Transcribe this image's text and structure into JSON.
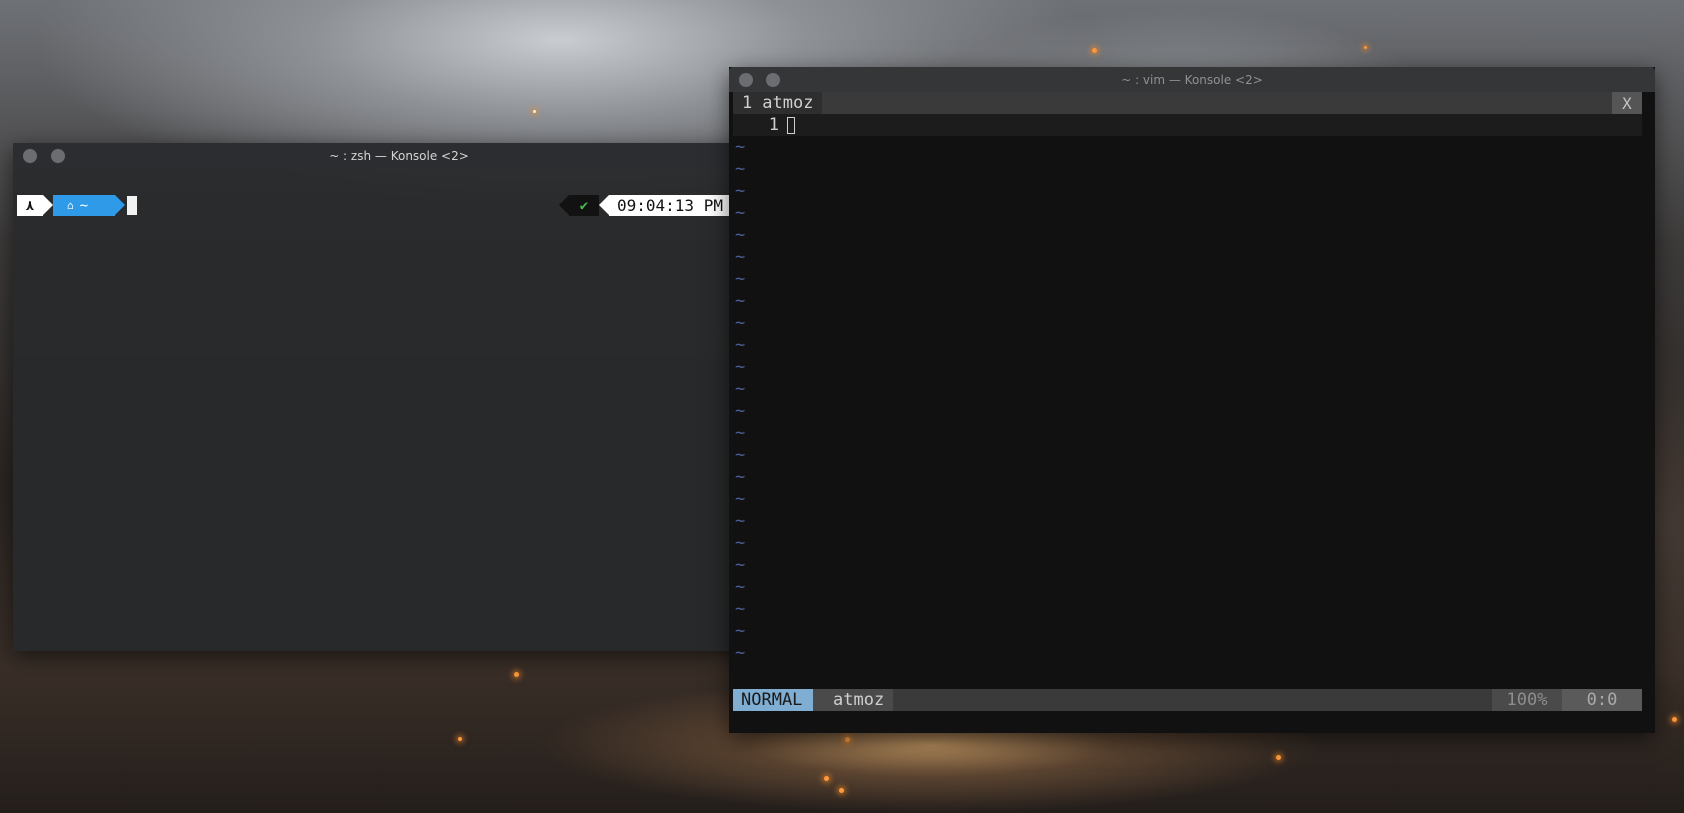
{
  "zsh_window": {
    "title": "~ : zsh — Konsole <2>",
    "prompt": {
      "os_icon": "arch-logo-icon",
      "os_glyph": "⋏",
      "home_icon": "home-icon",
      "home_glyph": "🏠",
      "path": "~",
      "status_glyph": "✔",
      "time": "09:04:13 PM",
      "clock_icon": "clock-icon"
    }
  },
  "vim_window": {
    "title": "~ : vim — Konsole <2>",
    "tabline": {
      "tab_number": "1",
      "tab_name": "atmoz",
      "close_label": "X"
    },
    "line_number": "1",
    "tilde": "~",
    "statusline": {
      "mode": "NORMAL",
      "filename": "atmoz",
      "percent": "100%",
      "position": "0:0"
    }
  },
  "colors": {
    "powerline_blue": "#2f9ae8",
    "status_ok_green": "#41c04a",
    "vim_mode_bg": "#7faed2",
    "vim_tilde": "#4a5f99"
  }
}
